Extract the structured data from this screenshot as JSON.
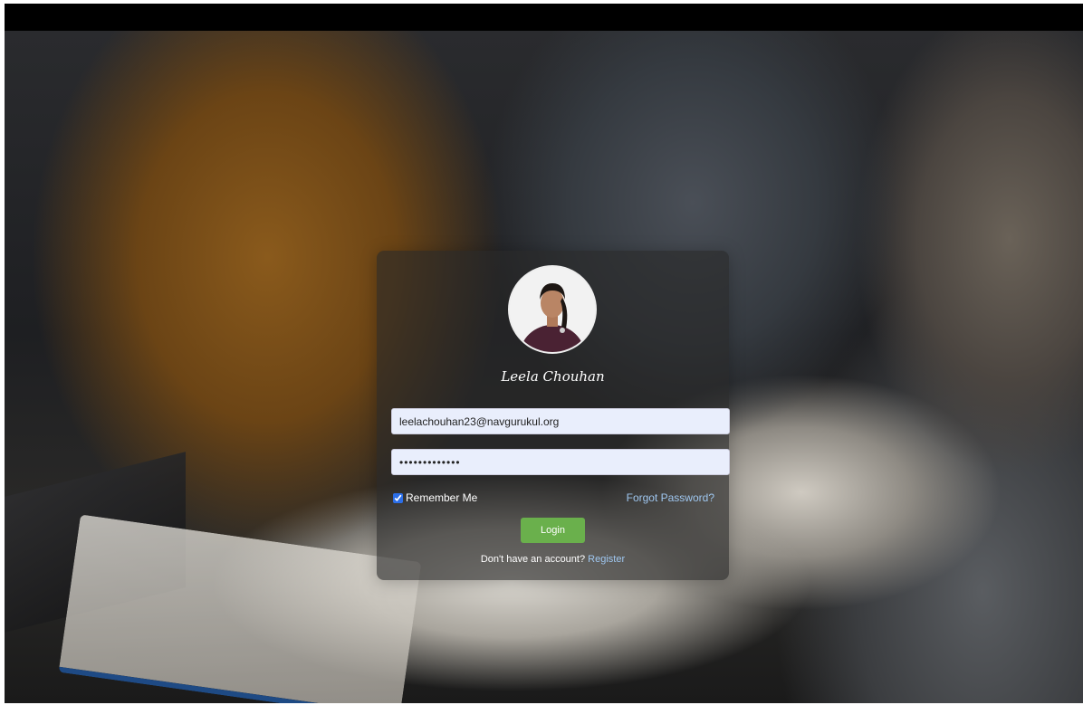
{
  "profile": {
    "name": "Leela Chouhan"
  },
  "form": {
    "email_value": "leelachouhan23@navgurukul.org",
    "password_value": "•••••••••••••",
    "remember_label": "Remember Me",
    "remember_checked": true,
    "forgot_label": "Forgot Password?",
    "login_label": "Login",
    "no_account_text": "Don't have an account?",
    "register_label": "Register"
  },
  "colors": {
    "login_button": "#6ab04c",
    "link": "#9fc7f0",
    "checkbox_accent": "#2b6ee8"
  }
}
